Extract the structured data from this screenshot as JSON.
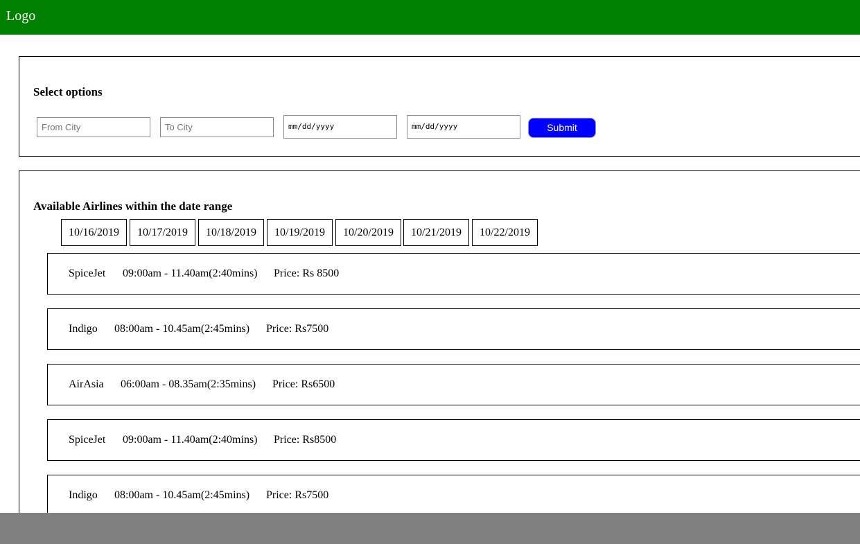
{
  "header": {
    "logo": "Logo",
    "bg_color": "#008000"
  },
  "search": {
    "title": "Select options",
    "from_placeholder": "From City",
    "to_placeholder": "To City",
    "date_placeholder_1": "mm/dd/yyyy",
    "date_placeholder_2": "mm/dd/yyyy",
    "submit_label": "Submit",
    "submit_color": "#0000ff"
  },
  "results": {
    "title": "Available Airlines within the date range",
    "dates": [
      "10/16/2019",
      "10/17/2019",
      "10/18/2019",
      "10/19/2019",
      "10/20/2019",
      "10/21/2019",
      "10/22/2019"
    ],
    "flights": [
      {
        "airline": "SpiceJet",
        "time": "09:00am - 11.40am(2:40mins)",
        "price": "Price: Rs 8500"
      },
      {
        "airline": "Indigo",
        "time": "08:00am - 10.45am(2:45mins)",
        "price": "Price: Rs7500"
      },
      {
        "airline": "AirAsia",
        "time": "06:00am - 08.35am(2:35mins)",
        "price": "Price: Rs6500"
      },
      {
        "airline": "SpiceJet",
        "time": "09:00am - 11.40am(2:40mins)",
        "price": "Price: Rs8500"
      },
      {
        "airline": "Indigo",
        "time": "08:00am - 10.45am(2:45mins)",
        "price": "Price: Rs7500"
      }
    ]
  },
  "footer": {
    "bg_color": "#808080"
  }
}
